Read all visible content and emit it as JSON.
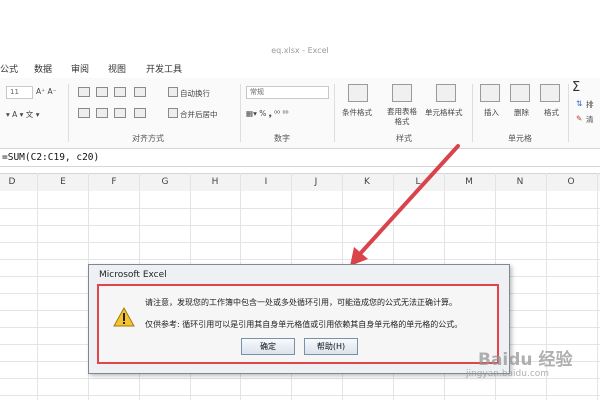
{
  "window": {
    "title": "eq.xlsx - Excel"
  },
  "tabs": [
    "公式",
    "数据",
    "审阅",
    "视图",
    "开发工具"
  ],
  "ribbon": {
    "wrap_text": "自动换行",
    "merge_center": "合并后居中",
    "number_format": "常规",
    "conditional_format": "条件格式",
    "table_format": "套用表格格式",
    "cell_style": "单元格样式",
    "insert": "插入",
    "delete": "删除",
    "format": "格式",
    "sum_symbol": "Σ",
    "sort_partial": "排",
    "clear_partial": "清",
    "font_size": "11",
    "groups": {
      "alignment": "对齐方式",
      "number": "数字",
      "styles": "样式",
      "cells": "单元格"
    }
  },
  "formula_bar": {
    "text": "=SUM(C2:C19, c20)"
  },
  "columns": [
    "D",
    "E",
    "F",
    "G",
    "H",
    "I",
    "J",
    "K",
    "L",
    "M",
    "N",
    "O"
  ],
  "dialog": {
    "title": "Microsoft Excel",
    "message": "请注意，发现您的工作簿中包含一处或多处循环引用，可能造成您的公式无法正确计算。",
    "note": "仅供参考: 循环引用可以是引用其自身单元格值或引用依赖其自身单元格的单元格的公式。",
    "ok_label": "确定",
    "help_label": "帮助(H)"
  },
  "watermark": {
    "text": "Baidu 经验",
    "sub": "jingyan.baidu.com"
  },
  "colors": {
    "highlight": "#e0454b",
    "arrow": "#d9434b"
  },
  "icons": [
    "warning-icon",
    "arrow-annotation"
  ]
}
